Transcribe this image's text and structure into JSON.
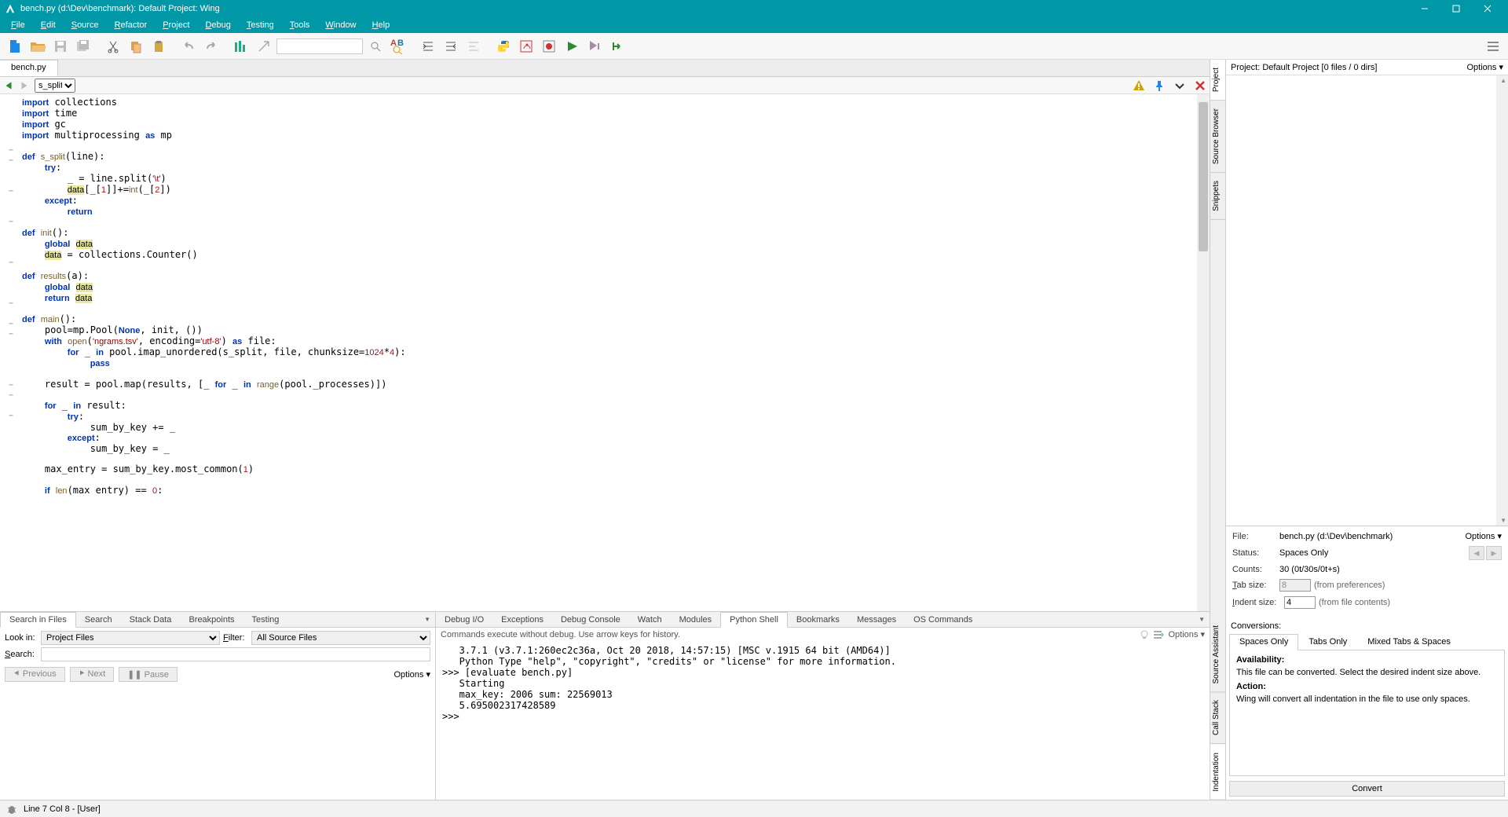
{
  "titlebar": {
    "title": "bench.py (d:\\Dev\\benchmark): Default Project: Wing"
  },
  "menu": [
    "File",
    "Edit",
    "Source",
    "Refactor",
    "Project",
    "Debug",
    "Testing",
    "Tools",
    "Window",
    "Help"
  ],
  "filetab": "bench.py",
  "editor_nav": {
    "symbol": "s_split"
  },
  "code_lines": [
    {
      "fold": "",
      "html": "<span class='kw'>import</span> collections"
    },
    {
      "fold": "",
      "html": "<span class='kw'>import</span> time"
    },
    {
      "fold": "",
      "html": "<span class='kw'>import</span> gc"
    },
    {
      "fold": "",
      "html": "<span class='kw'>import</span> multiprocessing <span class='kw'>as</span> mp"
    },
    {
      "fold": "",
      "html": ""
    },
    {
      "fold": "-",
      "html": "<span class='kw'>def</span> <span class='fn'>s_split</span>(line):"
    },
    {
      "fold": "-",
      "html": "    <span class='kw'>try</span>:"
    },
    {
      "fold": "",
      "html": "        _ = line.split(<span class='str'>'\\t'</span>)"
    },
    {
      "fold": "",
      "html": "        <span class='hl'>data</span>[_[<span class='num'>1</span>]]+=<span class='fn'>int</span>(_[<span class='num'>2</span>])"
    },
    {
      "fold": "-",
      "html": "    <span class='kw'>except</span>:"
    },
    {
      "fold": "",
      "html": "        <span class='kw'>return</span>"
    },
    {
      "fold": "",
      "html": ""
    },
    {
      "fold": "-",
      "html": "<span class='kw'>def</span> <span class='fn'>init</span>():"
    },
    {
      "fold": "",
      "html": "    <span class='kw'>global</span> <span class='hl'>data</span>"
    },
    {
      "fold": "",
      "html": "    <span class='hl'>data</span> = collections.Counter()"
    },
    {
      "fold": "",
      "html": ""
    },
    {
      "fold": "-",
      "html": "<span class='kw'>def</span> <span class='fn'>results</span>(a):"
    },
    {
      "fold": "",
      "html": "    <span class='kw'>global</span> <span class='hl'>data</span>"
    },
    {
      "fold": "",
      "html": "    <span class='kw'>return</span> <span class='hl'>data</span>"
    },
    {
      "fold": "",
      "html": ""
    },
    {
      "fold": "-",
      "html": "<span class='kw'>def</span> <span class='fn'>main</span>():"
    },
    {
      "fold": "",
      "html": "    pool=mp.Pool(<span class='kw'>None</span>, init, ())"
    },
    {
      "fold": "-",
      "html": "    <span class='kw'>with</span> <span class='fn'>open</span>(<span class='str'>'ngrams.tsv'</span>, encoding=<span class='str'>'utf-8'</span>) <span class='kw'>as</span> file:"
    },
    {
      "fold": "-",
      "html": "        <span class='kw'>for</span> _ <span class='kw'>in</span> pool.imap_unordered(s_split, file, chunksize=<span class='num'>1024</span>*<span class='num'>4</span>):"
    },
    {
      "fold": "",
      "html": "            <span class='kw'>pass</span>"
    },
    {
      "fold": "",
      "html": ""
    },
    {
      "fold": "",
      "html": "    result = pool.map(results, [_ <span class='kw'>for</span> _ <span class='kw'>in</span> <span class='fn'>range</span>(pool._processes)])"
    },
    {
      "fold": "",
      "html": ""
    },
    {
      "fold": "-",
      "html": "    <span class='kw'>for</span> _ <span class='kw'>in</span> result:"
    },
    {
      "fold": "-",
      "html": "        <span class='kw'>try</span>:"
    },
    {
      "fold": "",
      "html": "            sum_by_key += _"
    },
    {
      "fold": "-",
      "html": "        <span class='kw'>except</span>:"
    },
    {
      "fold": "",
      "html": "            sum_by_key = _"
    },
    {
      "fold": "",
      "html": ""
    },
    {
      "fold": "",
      "html": "    max_entry = sum_by_key.most_common(<span class='num'>1</span>)"
    },
    {
      "fold": "",
      "html": ""
    },
    {
      "fold": "",
      "html": "    <span class='kw'>if</span> <span class='fn'>len</span>(max entry) == <span class='num'>0</span>:"
    }
  ],
  "bleft": {
    "tabs": [
      "Search in Files",
      "Search",
      "Stack Data",
      "Breakpoints",
      "Testing"
    ],
    "active": 0,
    "lookin_label": "Look in:",
    "lookin_value": "Project Files",
    "filter_label": "Filter:",
    "filter_value": "All Source Files",
    "search_label": "Search:",
    "search_value": "",
    "prev": "Previous",
    "next": "Next",
    "pause": "Pause",
    "options": "Options"
  },
  "bright": {
    "tabs": [
      "Debug I/O",
      "Exceptions",
      "Debug Console",
      "Watch",
      "Modules",
      "Python Shell",
      "Bookmarks",
      "Messages",
      "OS Commands"
    ],
    "active": 5,
    "hint": "Commands execute without debug.  Use arrow keys for history.",
    "options": "Options",
    "lines": [
      "   3.7.1 (v3.7.1:260ec2c36a, Oct 20 2018, 14:57:15) [MSC v.1915 64 bit (AMD64)]",
      "   Python Type \"help\", \"copyright\", \"credits\" or \"license\" for more information.",
      ">>> [evaluate bench.py]",
      "   Starting",
      "   max_key: 2006 sum: 22569013",
      "   5.695002317428589",
      ">>> "
    ]
  },
  "right": {
    "vtabs_top": [
      "Project",
      "Source Browser",
      "Snippets"
    ],
    "vtabs_bottom": [
      "Source Assistant",
      "Call Stack",
      "Indentation"
    ],
    "proj_title": "Project: Default Project [0 files / 0 dirs]",
    "options": "Options",
    "sa": {
      "file_lbl": "File:",
      "file_val": "bench.py (d:\\Dev\\benchmark)",
      "status_lbl": "Status:",
      "status_val": "Spaces Only",
      "counts_lbl": "Counts:",
      "counts_val": "30 (0t/30s/0t+s)",
      "tabsize_lbl": "Tab size:",
      "tabsize_val": "8",
      "tabsize_hint": "(from preferences)",
      "indent_lbl": "Indent size:",
      "indent_val": "4",
      "indent_hint": "(from file contents)"
    },
    "conv": {
      "title": "Conversions:",
      "tabs": [
        "Spaces Only",
        "Tabs Only",
        "Mixed Tabs & Spaces"
      ],
      "active": 0,
      "avail_h": "Availability:",
      "avail_t": "This file can be converted. Select the desired indent size above.",
      "action_h": "Action:",
      "action_t": "Wing will convert all indentation in the file to use only spaces.",
      "btn": "Convert"
    }
  },
  "status": "Line 7 Col 8 - [User]"
}
